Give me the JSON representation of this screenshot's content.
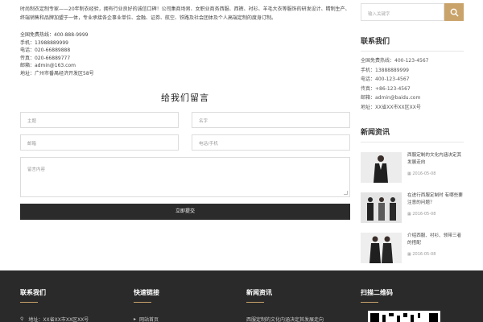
{
  "intro": "时尚制衣定制专家——20年制衣经验，拥有行业良好的诚信口碑！公司集商场男、女职业商务西服、西裤、衬衫、羊毛大衣等服饰的研发设计、精制生产、终端销售和品牌加盟于一体，专业承接各企事业单位、金融、证券、航空、铁路及社会团体及个人高端定制的度身订制。",
  "contacts": [
    "全国免费热线：400-888-9999",
    "手机：13988889999",
    "电话：020-66889888",
    "传真：020-66889777",
    "邮箱：admin@163.com",
    "地址：广州市番禺经济开发区58号"
  ],
  "form": {
    "title": "给我们留言",
    "name_placeholder": "主题",
    "contact_placeholder": "名字",
    "email_placeholder": "邮箱",
    "phone_placeholder": "电话/手机",
    "message_placeholder": "留言内容",
    "submit_label": "立即提交"
  },
  "sidebar": {
    "search_placeholder": "输入关键字",
    "contact_heading": "联系我们",
    "contacts": [
      "全国免费热线：400-123-4567",
      "手机：13888889999",
      "电话：400-123-4567",
      "传真：+86-123-4567",
      "邮箱：admin@baidu.com",
      "地址：XX省XX市XX区XX号"
    ],
    "news_heading": "新闻资讯",
    "news": [
      {
        "title": "西服定制的文化内涵决定其发展走向",
        "date": "2016-05-08"
      },
      {
        "title": "在进行西服定制时 有哪些要注意的问题？",
        "date": "2016-05-08"
      },
      {
        "title": "介绍西服、衬衫、领带三者的搭配",
        "date": "2016-05-08"
      }
    ]
  },
  "footer": {
    "col1_title": "联系我们",
    "col1_line": "地址：XX省XX市XX区XX号",
    "col2_title": "快速链接",
    "col2_line": "网站首页",
    "col3_title": "新闻资讯",
    "col3_line": "西服定制的文化内涵决定其发展走向",
    "col4_title": "扫描二维码"
  },
  "colors": {
    "accent": "#c9a36a",
    "footer_bg": "#2a2a2a",
    "button_bg": "#2b2b2b"
  }
}
